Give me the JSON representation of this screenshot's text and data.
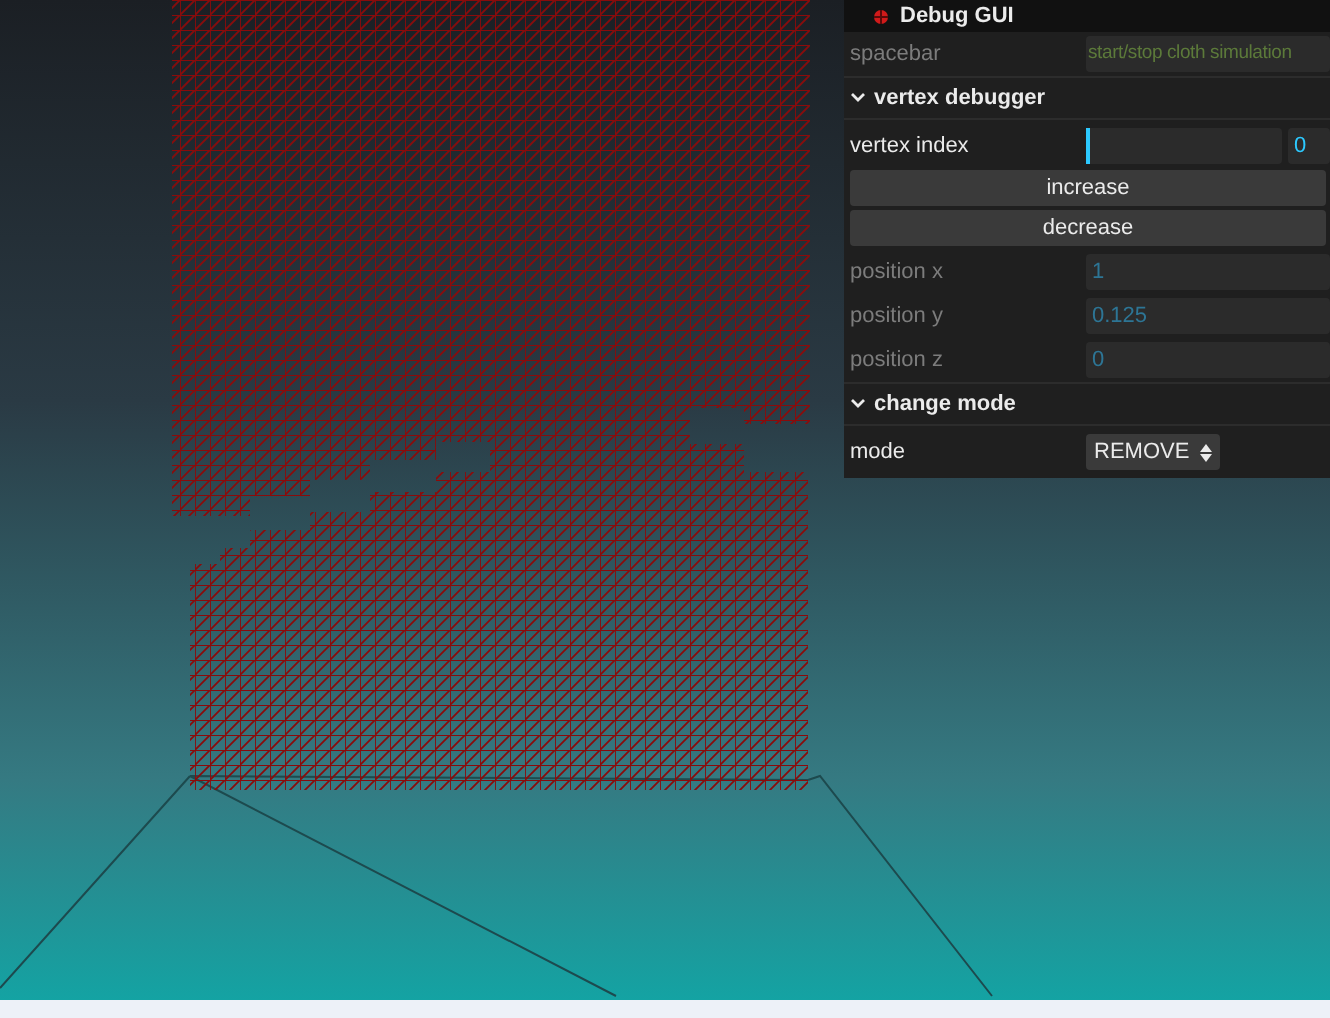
{
  "panel": {
    "title": "Debug GUI",
    "controllers": [
      {
        "kind": "text",
        "label": "spacebar",
        "value": "start/stop cloth simulation",
        "disabled": true
      }
    ],
    "folders": [
      {
        "title": "vertex debugger",
        "expanded": true,
        "controllers": [
          {
            "kind": "slider",
            "label": "vertex index",
            "level": 0,
            "value": "0",
            "disabled": false
          },
          {
            "kind": "button",
            "label": "increase",
            "disabled": false
          },
          {
            "kind": "button",
            "label": "decrease",
            "disabled": false
          },
          {
            "kind": "number",
            "label": "position x",
            "value": "1",
            "disabled": true
          },
          {
            "kind": "number",
            "label": "position y",
            "value": "0.125",
            "disabled": true
          },
          {
            "kind": "number",
            "label": "position z",
            "value": "0",
            "disabled": true
          }
        ]
      },
      {
        "title": "change mode",
        "expanded": true,
        "controllers": [
          {
            "kind": "select",
            "label": "mode",
            "value": "REMOVE",
            "disabled": false
          }
        ]
      }
    ]
  }
}
